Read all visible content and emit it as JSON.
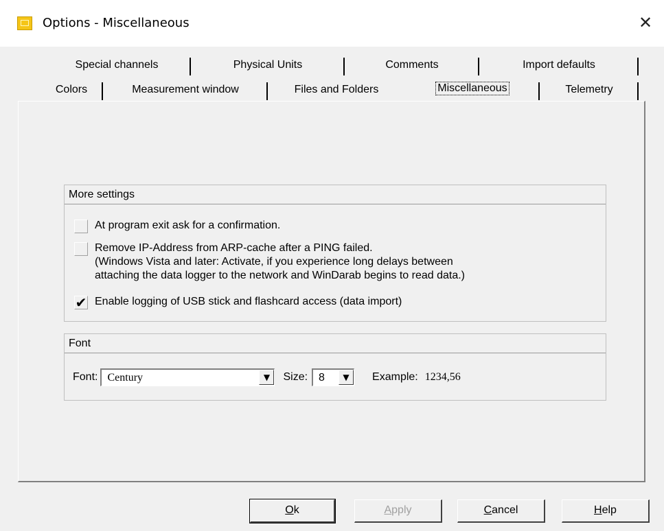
{
  "window": {
    "title": "Options - Miscellaneous",
    "close_glyph": "✕"
  },
  "tabs_row1": [
    {
      "label": "Special channels"
    },
    {
      "label": "Physical Units"
    },
    {
      "label": "Comments"
    },
    {
      "label": "Import defaults"
    }
  ],
  "tabs_row2": [
    {
      "label": "Colors"
    },
    {
      "label": "Measurement window"
    },
    {
      "label": "Files and Folders"
    },
    {
      "label": "Miscellaneous",
      "active": true
    },
    {
      "label": "Telemetry"
    }
  ],
  "more_settings": {
    "header": "More settings",
    "options": [
      {
        "label": "At program exit ask for a confirmation.",
        "checked": false
      },
      {
        "label": "Remove IP-Address from ARP-cache after a PING failed.",
        "checked": false,
        "note_line1": "(Windows Vista and later: Activate, if you experience long delays between",
        "note_line2": "attaching the data logger to the network and WinDarab begins to read data.)"
      },
      {
        "label": "Enable logging of USB stick and flashcard access (data import)",
        "checked": true,
        "mark": "✔"
      }
    ]
  },
  "font_group": {
    "header": "Font",
    "font_label": "Font:",
    "font_value": "Century",
    "size_label": "Size:",
    "size_value": "8",
    "example_label": "Example:",
    "example_value": "1234,56",
    "dropdown_glyph": "▼"
  },
  "buttons": {
    "ok": "Ok",
    "apply": "Apply",
    "cancel": "Cancel",
    "help": "Help"
  }
}
